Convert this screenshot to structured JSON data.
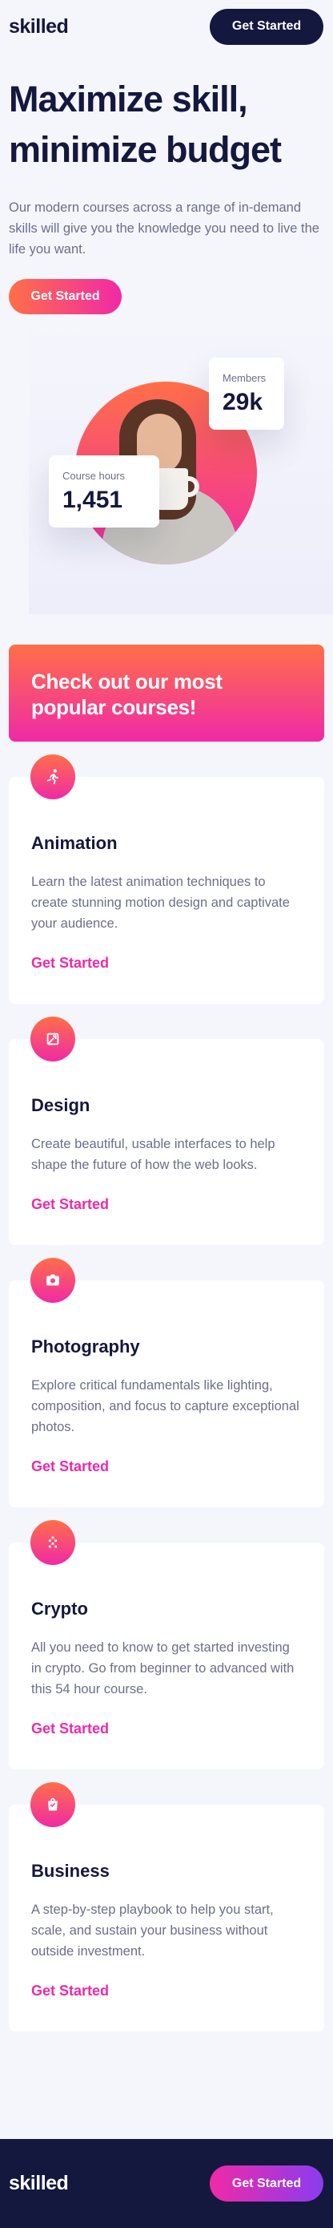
{
  "header": {
    "logo": "skilled",
    "cta_label": "Get Started"
  },
  "hero": {
    "title": "Maximize skill, minimize budget",
    "description": "Our modern courses across a range of in-demand skills will give you the knowledge you need to live the life you want.",
    "cta_label": "Get Started"
  },
  "stats": {
    "members_label": "Members",
    "members_value": "29k",
    "hours_label": "Course hours",
    "hours_value": "1,451"
  },
  "promo": {
    "title": "Check out our most popular courses!"
  },
  "courses": [
    {
      "icon": "running-person-icon",
      "title": "Animation",
      "description": "Learn the latest animation techniques to create stunning motion design and captivate your audience.",
      "link": "Get Started"
    },
    {
      "icon": "design-tool-icon",
      "title": "Design",
      "description": "Create beautiful, usable interfaces to help shape the future of how the web looks.",
      "link": "Get Started"
    },
    {
      "icon": "camera-icon",
      "title": "Photography",
      "description": "Explore critical fundamentals like lighting, composition, and focus to capture exceptional photos.",
      "link": "Get Started"
    },
    {
      "icon": "crypto-icon",
      "title": "Crypto",
      "description": "All you need to know to get started investing in crypto. Go from beginner to advanced with this 54 hour course.",
      "link": "Get Started"
    },
    {
      "icon": "shopping-bag-icon",
      "title": "Business",
      "description": "A step-by-step playbook to help you start, scale, and sustain your business without outside investment.",
      "link": "Get Started"
    }
  ],
  "footer": {
    "logo": "skilled",
    "cta_label": "Get Started"
  },
  "colors": {
    "navy": "#14183e",
    "gradient_start": "#ff6f48",
    "gradient_end": "#f02aa6",
    "footer_button_end": "#8a3cf0",
    "body_text": "#6b6f8a"
  }
}
